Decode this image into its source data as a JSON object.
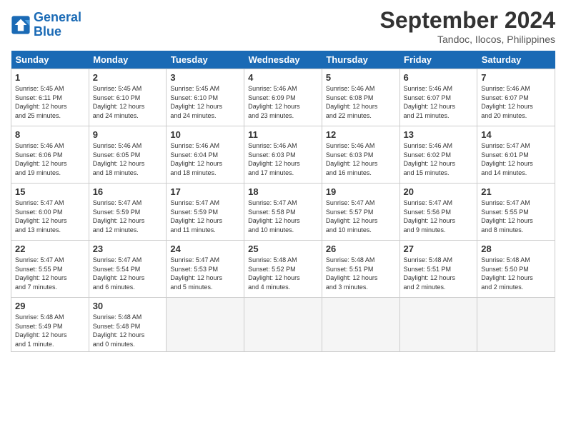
{
  "header": {
    "logo_line1": "General",
    "logo_line2": "Blue",
    "month": "September 2024",
    "location": "Tandoc, Ilocos, Philippines"
  },
  "weekdays": [
    "Sunday",
    "Monday",
    "Tuesday",
    "Wednesday",
    "Thursday",
    "Friday",
    "Saturday"
  ],
  "weeks": [
    [
      {
        "day": "1",
        "info": "Sunrise: 5:45 AM\nSunset: 6:11 PM\nDaylight: 12 hours\nand 25 minutes."
      },
      {
        "day": "2",
        "info": "Sunrise: 5:45 AM\nSunset: 6:10 PM\nDaylight: 12 hours\nand 24 minutes."
      },
      {
        "day": "3",
        "info": "Sunrise: 5:45 AM\nSunset: 6:10 PM\nDaylight: 12 hours\nand 24 minutes."
      },
      {
        "day": "4",
        "info": "Sunrise: 5:46 AM\nSunset: 6:09 PM\nDaylight: 12 hours\nand 23 minutes."
      },
      {
        "day": "5",
        "info": "Sunrise: 5:46 AM\nSunset: 6:08 PM\nDaylight: 12 hours\nand 22 minutes."
      },
      {
        "day": "6",
        "info": "Sunrise: 5:46 AM\nSunset: 6:07 PM\nDaylight: 12 hours\nand 21 minutes."
      },
      {
        "day": "7",
        "info": "Sunrise: 5:46 AM\nSunset: 6:07 PM\nDaylight: 12 hours\nand 20 minutes."
      }
    ],
    [
      {
        "day": "8",
        "info": "Sunrise: 5:46 AM\nSunset: 6:06 PM\nDaylight: 12 hours\nand 19 minutes."
      },
      {
        "day": "9",
        "info": "Sunrise: 5:46 AM\nSunset: 6:05 PM\nDaylight: 12 hours\nand 18 minutes."
      },
      {
        "day": "10",
        "info": "Sunrise: 5:46 AM\nSunset: 6:04 PM\nDaylight: 12 hours\nand 18 minutes."
      },
      {
        "day": "11",
        "info": "Sunrise: 5:46 AM\nSunset: 6:03 PM\nDaylight: 12 hours\nand 17 minutes."
      },
      {
        "day": "12",
        "info": "Sunrise: 5:46 AM\nSunset: 6:03 PM\nDaylight: 12 hours\nand 16 minutes."
      },
      {
        "day": "13",
        "info": "Sunrise: 5:46 AM\nSunset: 6:02 PM\nDaylight: 12 hours\nand 15 minutes."
      },
      {
        "day": "14",
        "info": "Sunrise: 5:47 AM\nSunset: 6:01 PM\nDaylight: 12 hours\nand 14 minutes."
      }
    ],
    [
      {
        "day": "15",
        "info": "Sunrise: 5:47 AM\nSunset: 6:00 PM\nDaylight: 12 hours\nand 13 minutes."
      },
      {
        "day": "16",
        "info": "Sunrise: 5:47 AM\nSunset: 5:59 PM\nDaylight: 12 hours\nand 12 minutes."
      },
      {
        "day": "17",
        "info": "Sunrise: 5:47 AM\nSunset: 5:59 PM\nDaylight: 12 hours\nand 11 minutes."
      },
      {
        "day": "18",
        "info": "Sunrise: 5:47 AM\nSunset: 5:58 PM\nDaylight: 12 hours\nand 10 minutes."
      },
      {
        "day": "19",
        "info": "Sunrise: 5:47 AM\nSunset: 5:57 PM\nDaylight: 12 hours\nand 10 minutes."
      },
      {
        "day": "20",
        "info": "Sunrise: 5:47 AM\nSunset: 5:56 PM\nDaylight: 12 hours\nand 9 minutes."
      },
      {
        "day": "21",
        "info": "Sunrise: 5:47 AM\nSunset: 5:55 PM\nDaylight: 12 hours\nand 8 minutes."
      }
    ],
    [
      {
        "day": "22",
        "info": "Sunrise: 5:47 AM\nSunset: 5:55 PM\nDaylight: 12 hours\nand 7 minutes."
      },
      {
        "day": "23",
        "info": "Sunrise: 5:47 AM\nSunset: 5:54 PM\nDaylight: 12 hours\nand 6 minutes."
      },
      {
        "day": "24",
        "info": "Sunrise: 5:47 AM\nSunset: 5:53 PM\nDaylight: 12 hours\nand 5 minutes."
      },
      {
        "day": "25",
        "info": "Sunrise: 5:48 AM\nSunset: 5:52 PM\nDaylight: 12 hours\nand 4 minutes."
      },
      {
        "day": "26",
        "info": "Sunrise: 5:48 AM\nSunset: 5:51 PM\nDaylight: 12 hours\nand 3 minutes."
      },
      {
        "day": "27",
        "info": "Sunrise: 5:48 AM\nSunset: 5:51 PM\nDaylight: 12 hours\nand 2 minutes."
      },
      {
        "day": "28",
        "info": "Sunrise: 5:48 AM\nSunset: 5:50 PM\nDaylight: 12 hours\nand 2 minutes."
      }
    ],
    [
      {
        "day": "29",
        "info": "Sunrise: 5:48 AM\nSunset: 5:49 PM\nDaylight: 12 hours\nand 1 minute."
      },
      {
        "day": "30",
        "info": "Sunrise: 5:48 AM\nSunset: 5:48 PM\nDaylight: 12 hours\nand 0 minutes."
      },
      {
        "day": "",
        "info": ""
      },
      {
        "day": "",
        "info": ""
      },
      {
        "day": "",
        "info": ""
      },
      {
        "day": "",
        "info": ""
      },
      {
        "day": "",
        "info": ""
      }
    ]
  ]
}
